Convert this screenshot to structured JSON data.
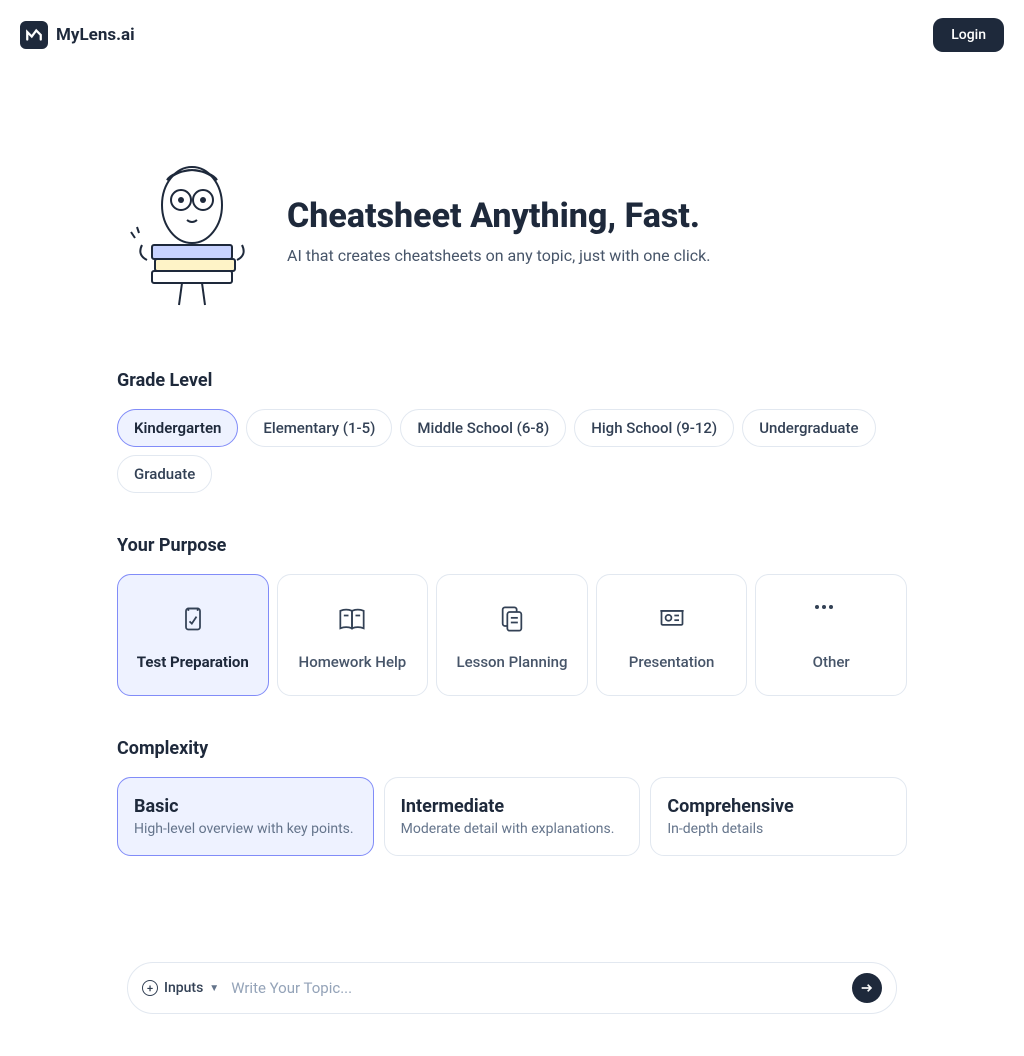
{
  "header": {
    "brand": "MyLens.ai",
    "login_label": "Login"
  },
  "hero": {
    "title": "Cheatsheet Anything, Fast.",
    "subtitle": "AI that creates cheatsheets on any topic, just with one click."
  },
  "grade_level": {
    "label": "Grade Level",
    "options": [
      {
        "label": "Kindergarten",
        "selected": true
      },
      {
        "label": "Elementary (1-5)",
        "selected": false
      },
      {
        "label": "Middle School (6-8)",
        "selected": false
      },
      {
        "label": "High School (9-12)",
        "selected": false
      },
      {
        "label": "Undergraduate",
        "selected": false
      },
      {
        "label": "Graduate",
        "selected": false
      }
    ]
  },
  "purpose": {
    "label": "Your Purpose",
    "options": [
      {
        "label": "Test Preparation",
        "icon": "clipboard-check-icon",
        "selected": true
      },
      {
        "label": "Homework Help",
        "icon": "book-open-icon",
        "selected": false
      },
      {
        "label": "Lesson Planning",
        "icon": "files-icon",
        "selected": false
      },
      {
        "label": "Presentation",
        "icon": "presentation-icon",
        "selected": false
      },
      {
        "label": "Other",
        "icon": "dots-icon",
        "selected": false
      }
    ]
  },
  "complexity": {
    "label": "Complexity",
    "options": [
      {
        "title": "Basic",
        "desc": "High-level overview with key points.",
        "selected": true
      },
      {
        "title": "Intermediate",
        "desc": "Moderate detail with explanations.",
        "selected": false
      },
      {
        "title": "Comprehensive",
        "desc": "In-depth details",
        "selected": false
      }
    ]
  },
  "input_bar": {
    "inputs_label": "Inputs",
    "placeholder": "Write Your Topic..."
  }
}
